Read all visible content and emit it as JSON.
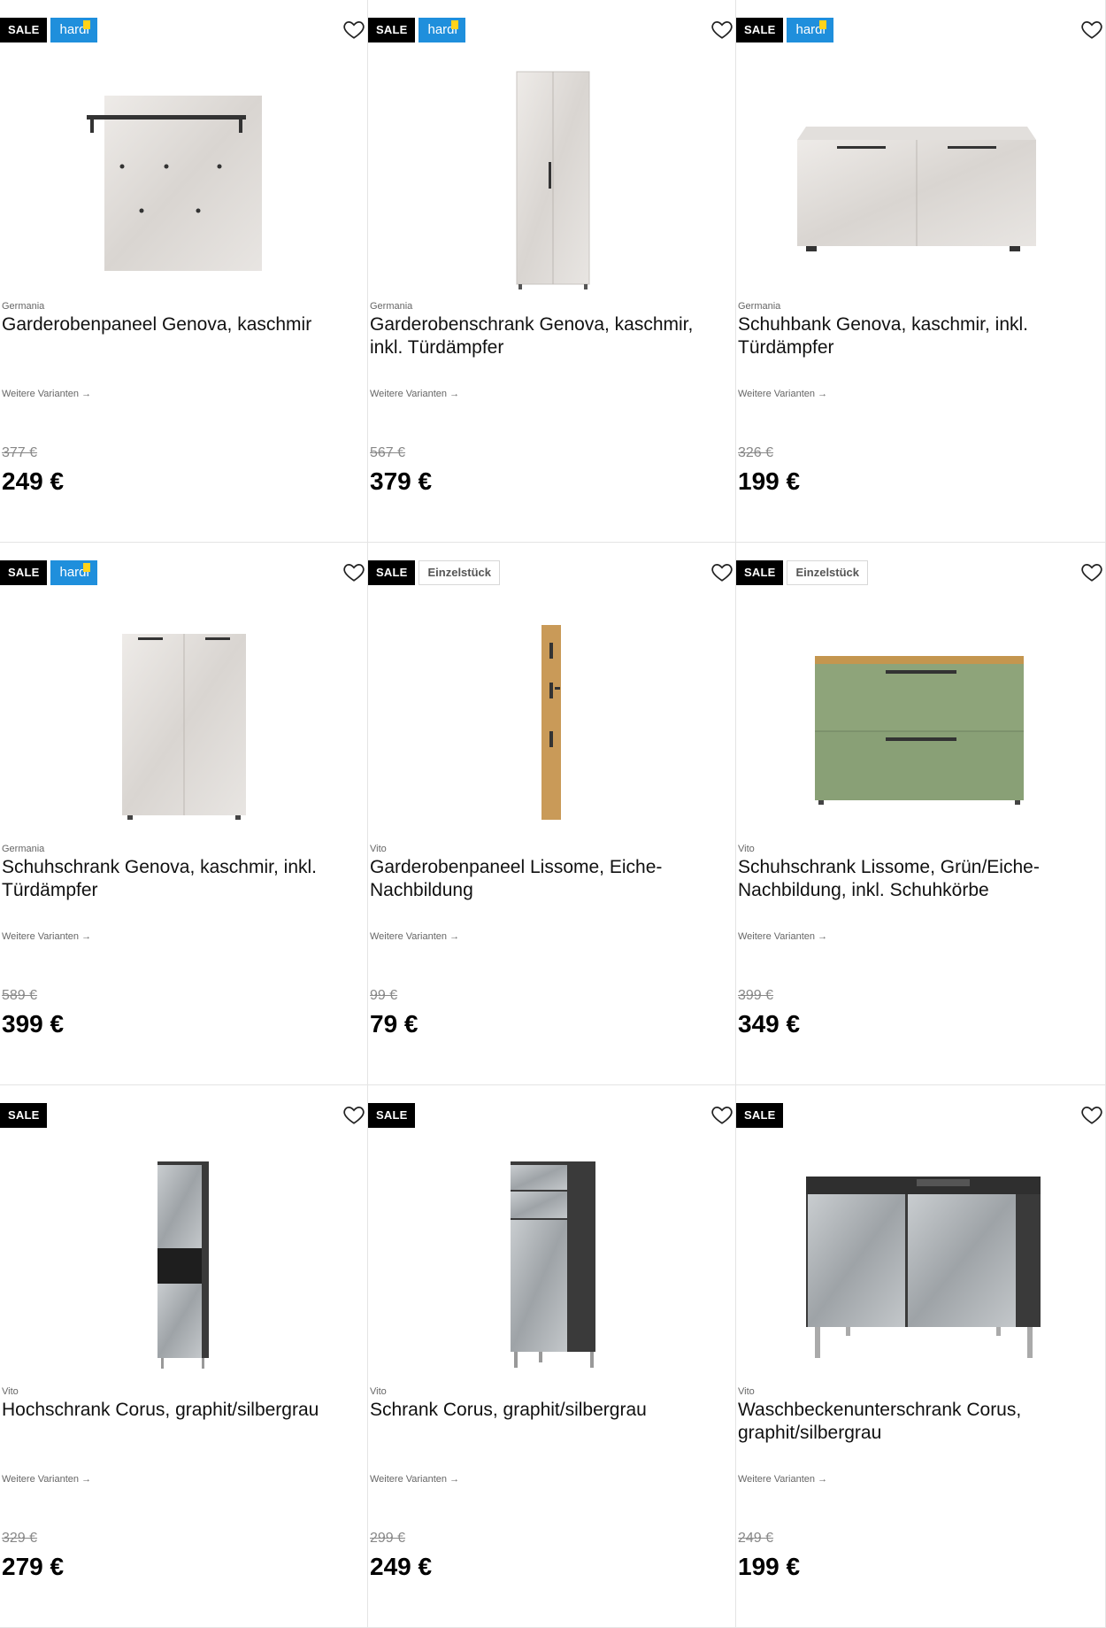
{
  "products": [
    {
      "badges": [
        "SALE",
        "hardi"
      ],
      "brand": "Germania",
      "title": "Garderobenpaneel Genova, kaschmir",
      "variants": "Weitere Varianten →",
      "old_price": "377 €",
      "price": "249 €",
      "image": "coat-panel-icon"
    },
    {
      "badges": [
        "SALE",
        "hardi"
      ],
      "brand": "Germania",
      "title": "Garderobenschrank Genova, kaschmir, inkl. Türdämpfer",
      "variants": "Weitere Varianten →",
      "old_price": "567 €",
      "price": "379 €",
      "image": "tall-wardrobe-icon"
    },
    {
      "badges": [
        "SALE",
        "hardi"
      ],
      "brand": "Germania",
      "title": "Schuhbank Genova, kaschmir, inkl. Türdämpfer",
      "variants": "Weitere Varianten →",
      "old_price": "326 €",
      "price": "199 €",
      "image": "shoe-bench-icon"
    },
    {
      "badges": [
        "SALE",
        "hardi"
      ],
      "brand": "Germania",
      "title": "Schuhschrank Genova, kaschmir, inkl. Türdämpfer",
      "variants": "Weitere Varianten →",
      "old_price": "589 €",
      "price": "399 €",
      "image": "shoe-cabinet-icon"
    },
    {
      "badges": [
        "SALE",
        "Einzelstück"
      ],
      "brand": "Vito",
      "title": "Garderobenpaneel Lissome, Eiche-Nachbildung",
      "variants": "Weitere Varianten →",
      "old_price": "99 €",
      "price": "79 €",
      "image": "wood-hook-panel-icon"
    },
    {
      "badges": [
        "SALE",
        "Einzelstück"
      ],
      "brand": "Vito",
      "title": "Schuhschrank Lissome, Grün/Eiche-Nachbildung, inkl. Schuhkörbe",
      "variants": "Weitere Varianten →",
      "old_price": "399 €",
      "price": "349 €",
      "image": "green-shoe-cabinet-icon"
    },
    {
      "badges": [
        "SALE"
      ],
      "brand": "Vito",
      "title": "Hochschrank Corus, graphit/silbergrau",
      "variants": "Weitere Varianten →",
      "old_price": "329 €",
      "price": "279 €",
      "image": "tall-bath-cabinet-icon"
    },
    {
      "badges": [
        "SALE"
      ],
      "brand": "Vito",
      "title": "Schrank Corus, graphit/silbergrau",
      "variants": "Weitere Varianten →",
      "old_price": "299 €",
      "price": "249 €",
      "image": "bath-cabinet-icon"
    },
    {
      "badges": [
        "SALE"
      ],
      "brand": "Vito",
      "title": "Waschbeckenunterschrank Corus, graphit/silbergrau",
      "variants": "Weitere Varianten →",
      "old_price": "249 €",
      "price": "199 €",
      "image": "vanity-unit-icon"
    }
  ],
  "colors": {
    "sale": "#000000",
    "hardi": "#1f8fdc",
    "accent": "#ffd31a"
  }
}
